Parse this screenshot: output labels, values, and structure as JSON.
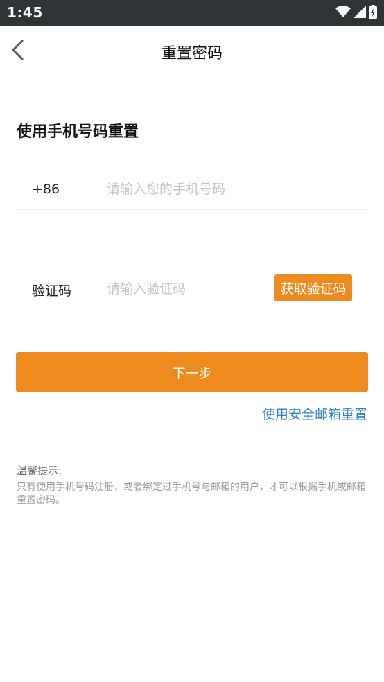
{
  "status_bar": {
    "time": "1:45",
    "icons": [
      "wifi-icon",
      "signal-icon",
      "battery-charging-icon"
    ]
  },
  "nav": {
    "back_icon": "chevron-left-icon",
    "title": "重置密码"
  },
  "form": {
    "section_title": "使用手机号码重置",
    "phone": {
      "country_code": "+86",
      "placeholder": "请输入您的手机号码",
      "value": ""
    },
    "code": {
      "label": "验证码",
      "placeholder": "请输入验证码",
      "value": "",
      "get_code_label": "获取验证码"
    },
    "next_label": "下一步",
    "email_reset_link": "使用安全邮箱重置"
  },
  "tips": {
    "title": "温馨提示:",
    "body": "只有使用手机号码注册，或者绑定过手机号与邮箱的用户，才可以根据手机或邮箱重置密码。"
  },
  "colors": {
    "accent": "#ee8b1e",
    "link": "#2f7fd2",
    "status_bar": "#2f3537"
  }
}
